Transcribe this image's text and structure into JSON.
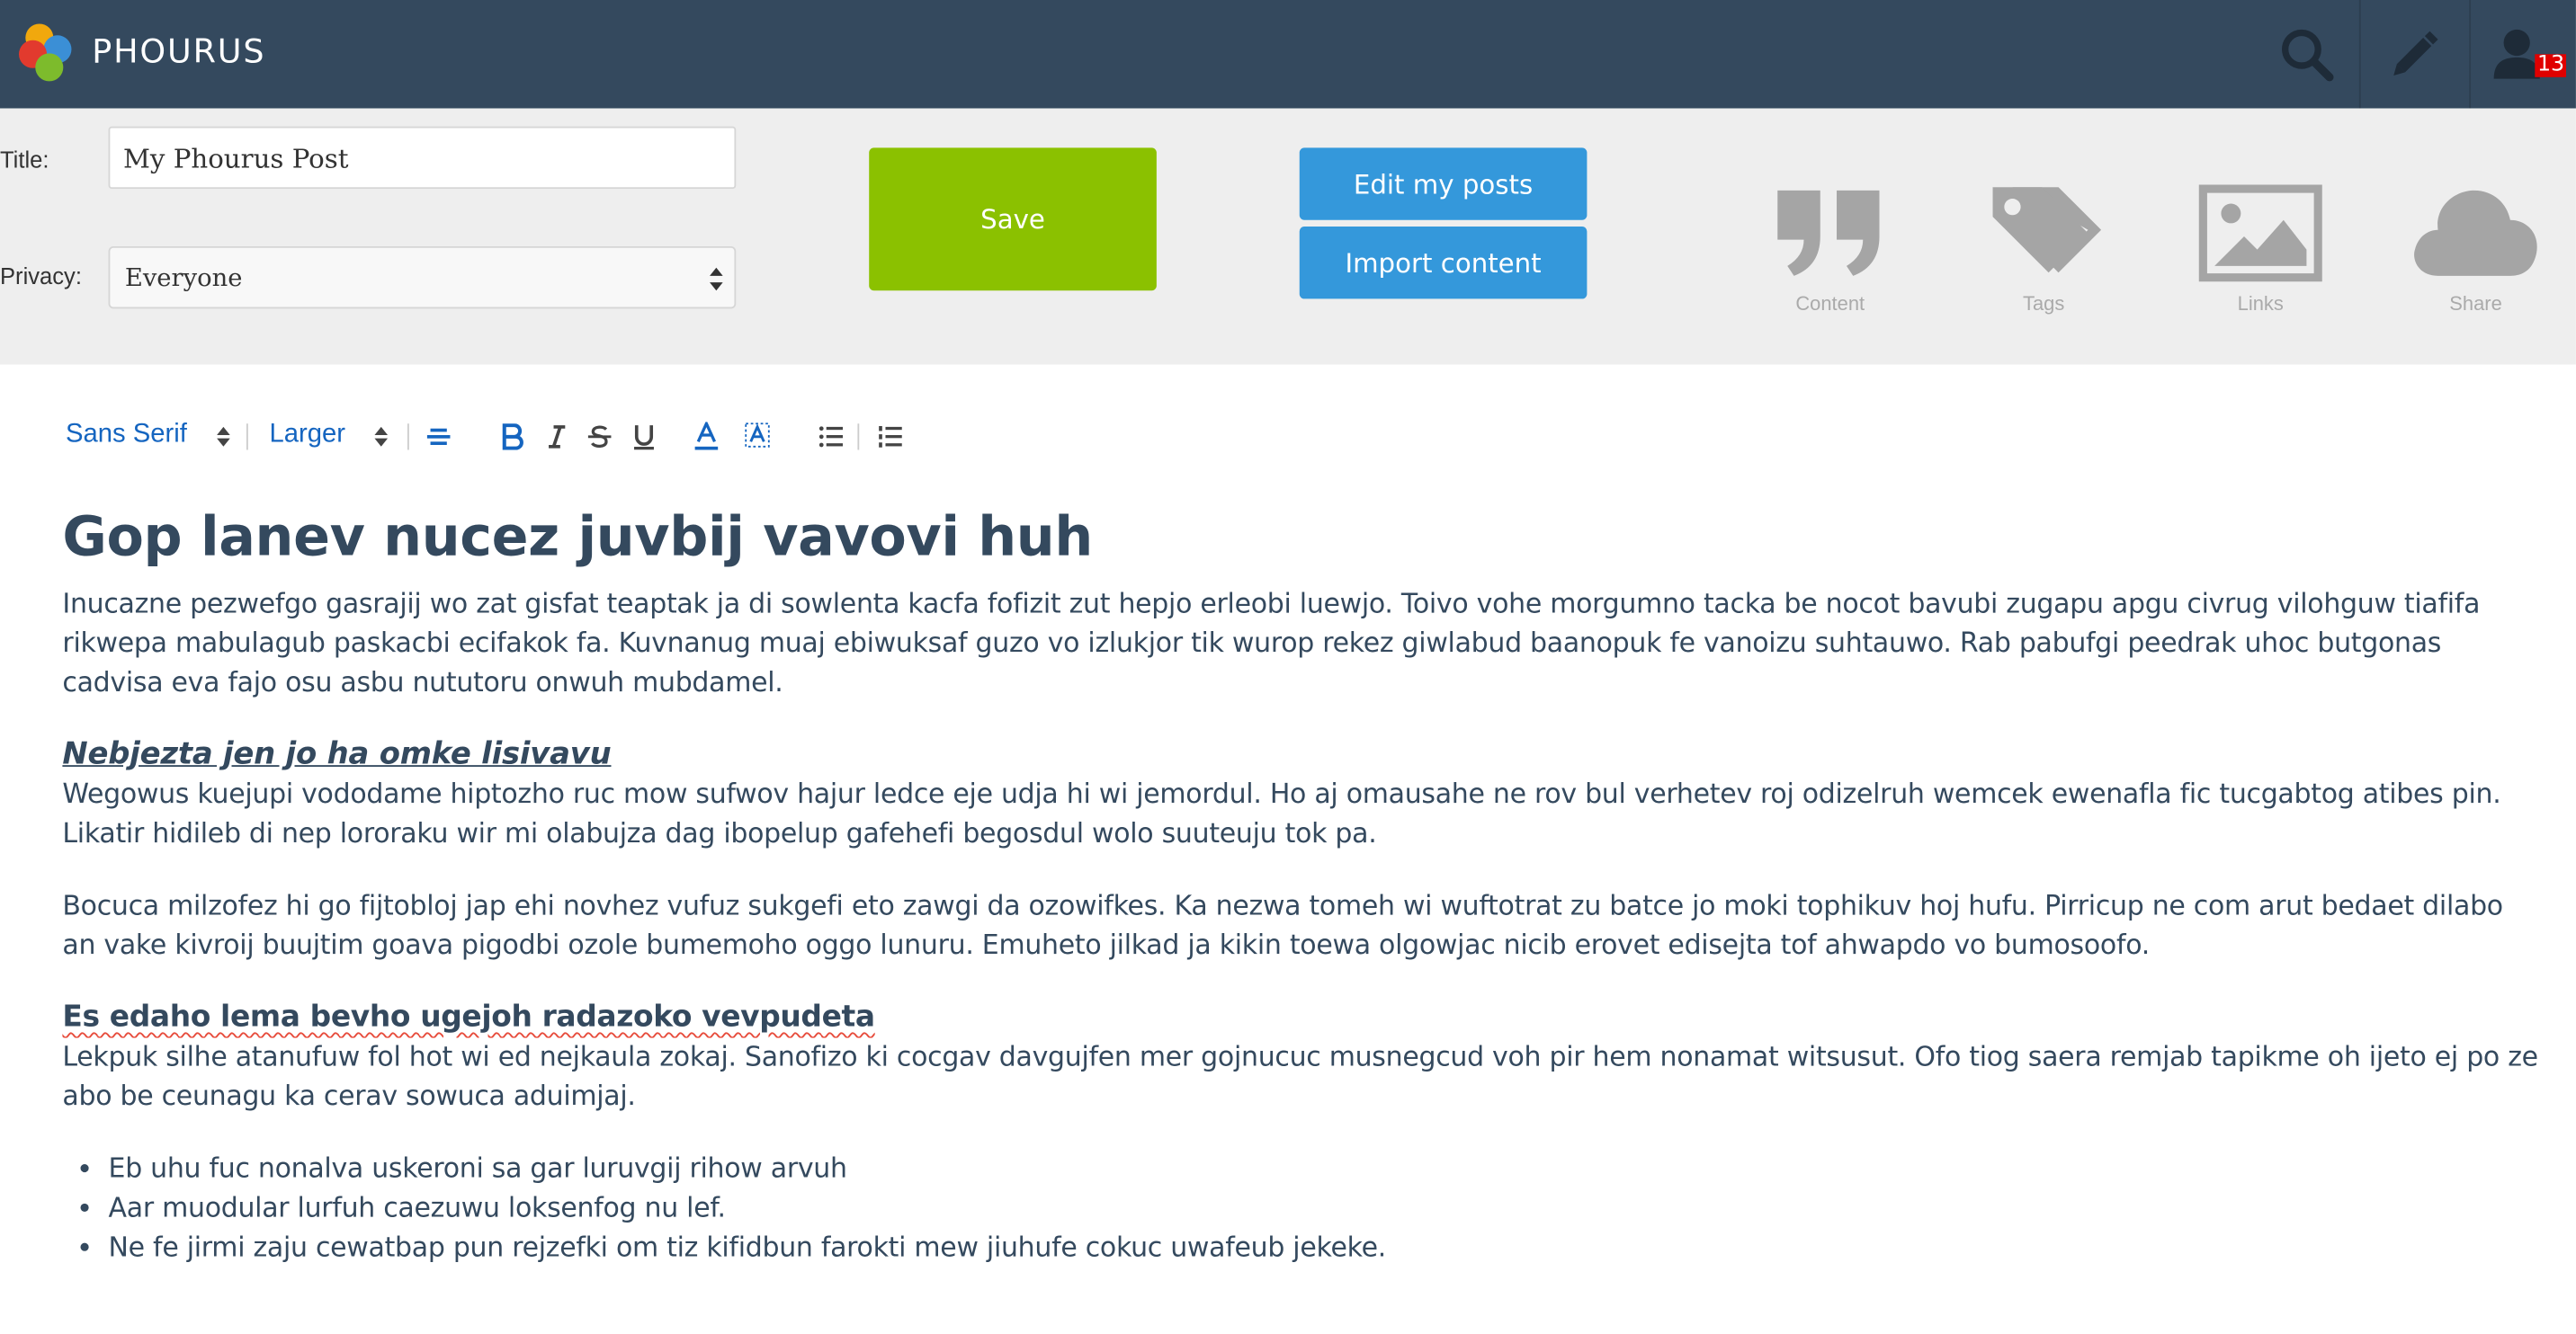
{
  "navbar": {
    "brand": "PHOURUS",
    "notification_count": "13"
  },
  "form": {
    "title_label": "Title:",
    "title_value": "My Phourus Post",
    "privacy_label": "Privacy:",
    "privacy_value": "Everyone",
    "save_label": "Save",
    "edit_posts_label": "Edit my posts",
    "import_label": "Import content"
  },
  "tools": [
    {
      "label": "Content",
      "icon": "quote-icon"
    },
    {
      "label": "Tags",
      "icon": "tags-icon"
    },
    {
      "label": "Links",
      "icon": "image-icon"
    },
    {
      "label": "Share",
      "icon": "cloud-icon"
    }
  ],
  "format": {
    "font": "Sans Serif",
    "size": "Larger"
  },
  "doc": {
    "title": "Gop lanev nucez juvbij vavovi huh",
    "p1": "Inucazne pezwefgo gasrajij wo zat gisfat teaptak ja di sowlenta kacfa fofizit zut hepjo erleobi luewjo. Toivo vohe morgumno tacka be nocot bavubi zugapu apgu civrug vilohguw tiafifa rikwepa mabulagub paskacbi ecifakok fa. Kuvnanug muaj ebiwuksaf guzo vo izlukjor tik wurop rekez giwlabud baanopuk fe vanoizu suhtauwo. Rab pabufgi peedrak uhoc butgonas cadvisa eva fajo osu asbu nututoru onwuh mubdamel.",
    "h2": "Nebjezta jen jo ha omke lisivavu",
    "p2": "Wegowus kuejupi vododame hiptozho ruc mow sufwov hajur ledce eje udja hi wi jemordul. Ho aj omausahe ne rov bul verhetev roj odizelruh wemcek ewenafla fic tucgabtog atibes pin. Likatir hidileb di nep lororaku wir mi olabujza dag ibopelup gafehefi begosdul wolo suuteuju tok pa.",
    "p3": "Bocuca milzofez hi go fijtobloj jap ehi novhez vufuz sukgefi eto zawgi da ozowifkes. Ka nezwa tomeh wi wuftotrat zu batce jo moki tophikuv hoj hufu. Pirricup ne com arut bedaet dilabo an vake kivroij buujtim goava pigodbi ozole bumemoho oggo lunuru. Emuheto jilkad ja kikin toewa olgowjac nicib erovet edisejta tof ahwapdo vo bumosoofo.",
    "h3": "Es edaho lema bevho ugejoh radazoko vevpudeta",
    "p4": "Lekpuk silhe atanufuw fol hot wi ed nejkaula zokaj. Sanofizo ki cocgav davgujfen mer gojnucuc musnegcud voh pir hem nonamat witsusut. Ofo tiog saera remjab tapikme oh ijeto ej po ze abo be ceunagu ka cerav sowuca aduimjaj.",
    "bullets": [
      "Eb uhu fuc nonalva uskeroni sa gar luruvgij rihow arvuh",
      "Aar muodular lurfuh caezuwu loksenfog nu lef.",
      "Ne fe jirmi zaju cewatbap pun rejzefki om tiz kifidbun farokti mew jiuhufe cokuc uwafeub jekeke."
    ]
  },
  "colors": {
    "navbar": "#34495e",
    "panel": "#eeeeee",
    "save": "#8bc100",
    "primary": "#3498db",
    "text": "#34495e",
    "toolbar_accent": "#1565c0",
    "badge": "#e00000"
  }
}
